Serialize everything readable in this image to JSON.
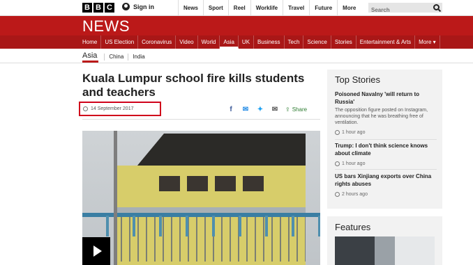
{
  "topbar": {
    "logo_letters": [
      "B",
      "B",
      "C"
    ],
    "sign_in": "Sign in",
    "nav": [
      "News",
      "Sport",
      "Reel",
      "Worklife",
      "Travel",
      "Future",
      "More"
    ],
    "search_placeholder": "Search"
  },
  "header": {
    "title": "NEWS"
  },
  "rednav": {
    "items": [
      "Home",
      "US Election",
      "Coronavirus",
      "Video",
      "World",
      "Asia",
      "UK",
      "Business",
      "Tech",
      "Science",
      "Stories",
      "Entertainment & Arts",
      "More"
    ],
    "active": "Asia"
  },
  "subnav": {
    "section": "Asia",
    "items": [
      "China",
      "India"
    ]
  },
  "article": {
    "headline": "Kuala Lumpur school fire kills students and teachers",
    "date": "14 September 2017",
    "share_label": "Share"
  },
  "top_stories": {
    "title": "Top Stories",
    "stories": [
      {
        "headline": "Poisoned Navalny 'will return to Russia'",
        "summary": "The opposition figure posted on Instagram, announcing that he was breathing free of ventilation.",
        "time": "1 hour ago"
      },
      {
        "headline": "Trump: I don't think science knows about climate",
        "summary": "",
        "time": "1 hour ago"
      },
      {
        "headline": "US bars Xinjiang exports over China rights abuses",
        "summary": "",
        "time": "2 hours ago"
      }
    ]
  },
  "features": {
    "title": "Features"
  },
  "colors": {
    "brand_red": "#bb1919",
    "highlight_box": "#d0021b"
  }
}
